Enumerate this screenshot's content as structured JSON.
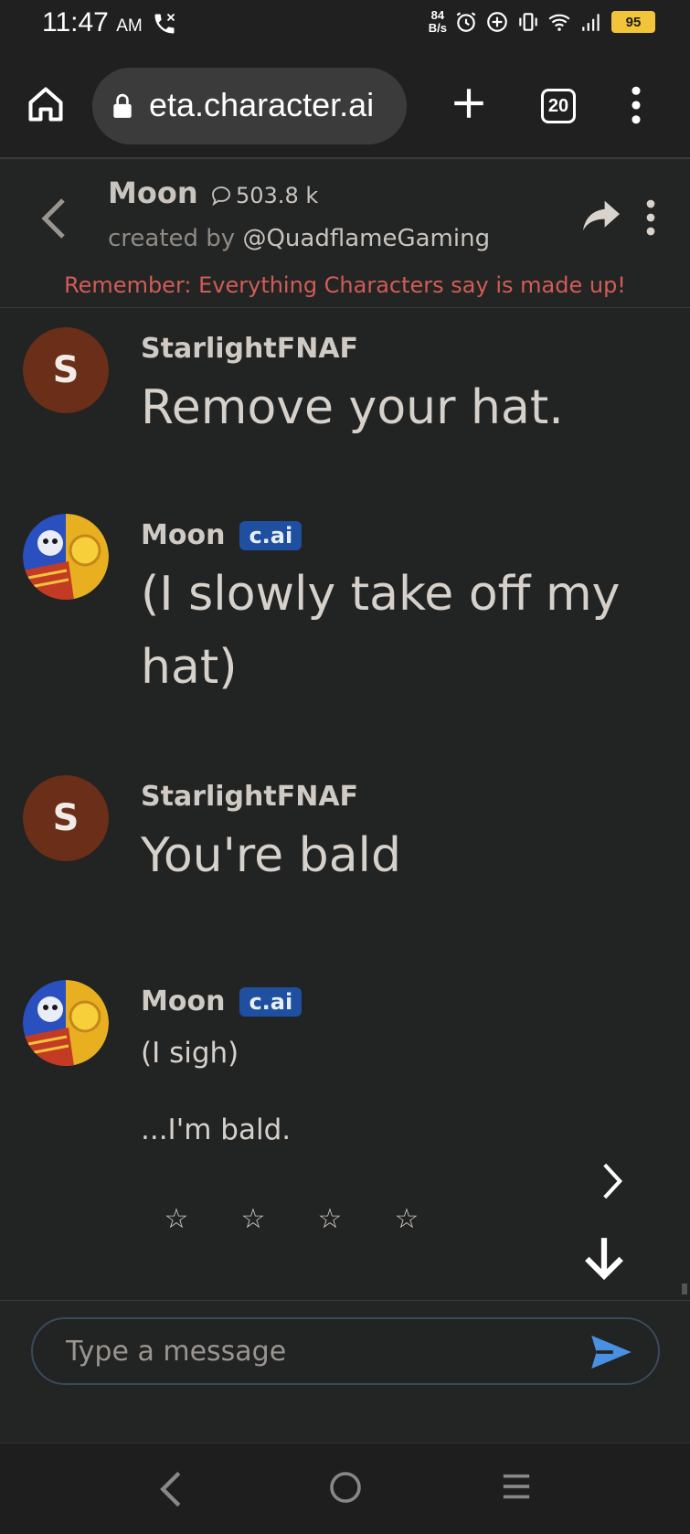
{
  "status_bar": {
    "time": "11:47",
    "ampm": "AM",
    "net_speed_value": "84",
    "net_speed_unit": "B/s",
    "battery": "95"
  },
  "browser": {
    "url": "eta.character.ai",
    "tab_count": "20"
  },
  "chat_header": {
    "character_name": "Moon",
    "message_count": "503.8 k",
    "created_by_prefix": "created by ",
    "creator_handle": "@QuadflameGaming",
    "disclaimer": "Remember: Everything Characters say is made up!"
  },
  "messages": [
    {
      "sender": "StarlightFNAF",
      "avatar_letter": "S",
      "text": "Remove your hat."
    },
    {
      "sender": "Moon",
      "badge": "c.ai",
      "text": "(I slowly take off my hat)"
    },
    {
      "sender": "StarlightFNAF",
      "avatar_letter": "S",
      "text": "You're bald"
    },
    {
      "sender": "Moon",
      "badge": "c.ai",
      "line1": "(I sigh)",
      "line2": "...I'm bald."
    }
  ],
  "rating": {
    "stars": [
      "☆",
      "☆",
      "☆",
      "☆"
    ]
  },
  "composer": {
    "placeholder": "Type a message"
  },
  "colors": {
    "background": "#222323",
    "accent_blue": "#4a90e2",
    "badge_blue": "#1e4fa0",
    "disclaimer_red": "#d25c55",
    "user_avatar": "#6b2e18",
    "battery_yellow": "#f2c43a"
  },
  "icons": {
    "home": "home-icon",
    "lock": "lock-icon",
    "new_tab": "plus-icon",
    "tabs": "tabs-icon",
    "menu": "more-vertical-icon",
    "back": "chevron-left-icon",
    "chat_bubble": "chat-bubble-icon",
    "share": "share-icon",
    "next": "chevron-right-icon",
    "scroll_down": "arrow-down-icon",
    "send": "send-icon"
  }
}
